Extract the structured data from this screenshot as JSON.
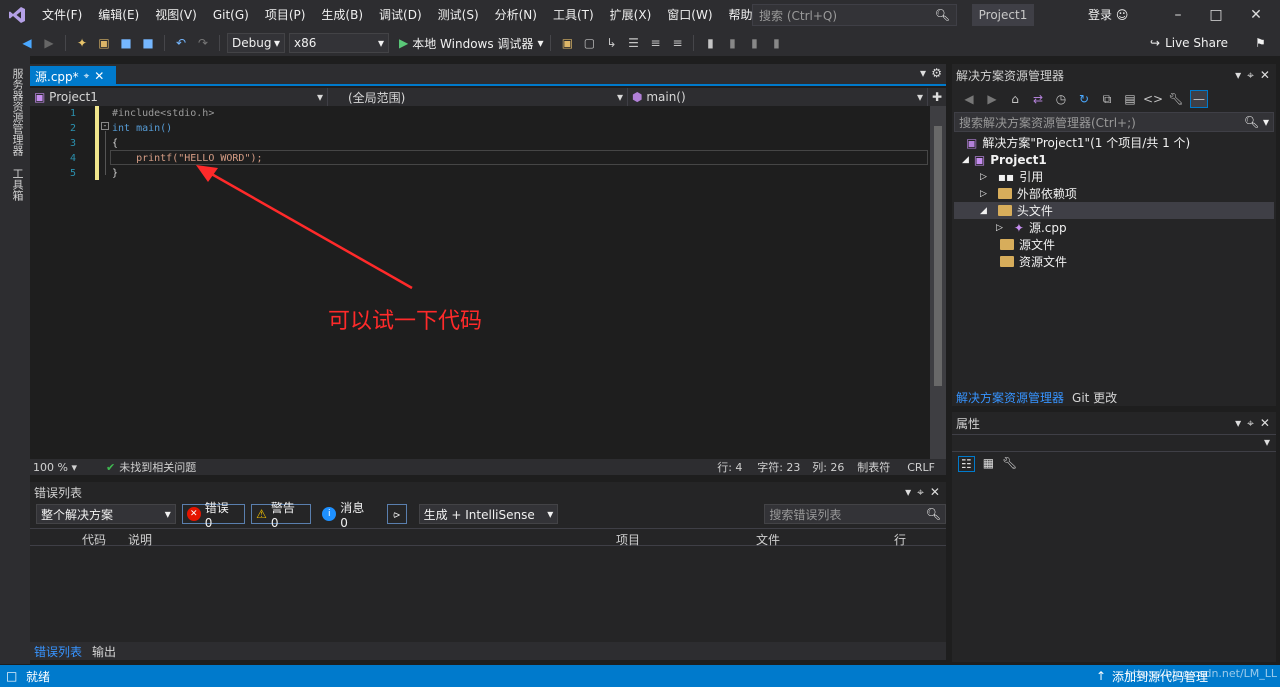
{
  "menu": [
    "文件(F)",
    "编辑(E)",
    "视图(V)",
    "Git(G)",
    "项目(P)",
    "生成(B)",
    "调试(D)",
    "测试(S)",
    "分析(N)",
    "工具(T)",
    "扩展(X)",
    "窗口(W)",
    "帮助(H)"
  ],
  "search": {
    "placeholder": "搜索 (Ctrl+Q)"
  },
  "project_badge": "Project1",
  "login": "登录",
  "toolbar": {
    "config": "Debug",
    "platform": "x86",
    "run_label": "本地 Windows 调试器",
    "live_share": "Live Share"
  },
  "left_tabs": [
    "服务器资源管理器",
    "工具箱"
  ],
  "editor": {
    "tab_label": "源.cpp*",
    "nav_project": "Project1",
    "nav_scope": "(全局范围)",
    "nav_func": "main()",
    "lines": [
      {
        "num": "1",
        "text": "#include<stdio.h>"
      },
      {
        "num": "2",
        "text": "int main()"
      },
      {
        "num": "3",
        "text": "{"
      },
      {
        "num": "4",
        "text": "    printf(\"HELLO WORD\");"
      },
      {
        "num": "5",
        "text": "}"
      }
    ],
    "annotation": "可以试一下代码"
  },
  "editor_status": {
    "zoom": "100 %",
    "issues": "未找到相关问题",
    "line": "行: 4",
    "char": "字符: 23",
    "col": "列: 26",
    "tabs": "制表符",
    "eol": "CRLF"
  },
  "error_list": {
    "title": "错误列表",
    "scope": "整个解决方案",
    "errors": "错误 0",
    "warnings": "警告 0",
    "messages": "消息 0",
    "build_filter": "生成 + IntelliSense",
    "search_placeholder": "搜索错误列表",
    "columns": [
      "代码",
      "说明",
      "项目",
      "文件",
      "行"
    ],
    "tabs": [
      "错误列表",
      "输出"
    ]
  },
  "solution": {
    "title": "解决方案资源管理器",
    "search_placeholder": "搜索解决方案资源管理器(Ctrl+;)",
    "items": [
      {
        "label": "解决方案\"Project1\"(1 个项目/共 1 个)"
      },
      {
        "label": "Project1"
      },
      {
        "label": "引用"
      },
      {
        "label": "外部依赖项"
      },
      {
        "label": "头文件"
      },
      {
        "label": "源.cpp"
      },
      {
        "label": "源文件"
      },
      {
        "label": "资源文件"
      }
    ],
    "tabs": [
      "解决方案资源管理器",
      "Git 更改"
    ]
  },
  "properties": {
    "title": "属性"
  },
  "statusbar": {
    "ready": "就绪",
    "add_source": "添加到源代码管理",
    "watermark": "https://blog.csdn.net/LM_LL"
  },
  "colors": {
    "accent": "#007acc",
    "annotation": "#ff2a2a"
  }
}
